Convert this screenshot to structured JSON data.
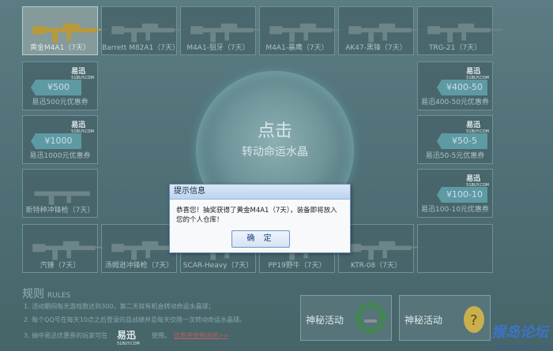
{
  "weapons_row1": [
    {
      "label": "黄金M4A1（7天）",
      "selected": true
    },
    {
      "label": "Barrett M82A1（7天）"
    },
    {
      "label": "M4A1-狙牙（7天）"
    },
    {
      "label": "M4A1-暴鹰（7天）"
    },
    {
      "label": "AK47-黑锋（7天）"
    },
    {
      "label": "TRG-21（7天）"
    }
  ],
  "vouchers_left": [
    {
      "amount": "¥500",
      "label": "易迅500元优惠券",
      "logo": "易迅",
      "logo_sub": "51BUY.COM"
    },
    {
      "amount": "¥1000",
      "label": "易迅1000元优惠券",
      "logo": "易迅",
      "logo_sub": "51BUY.COM"
    }
  ],
  "vouchers_right": [
    {
      "amount": "¥400-50",
      "label": "易迅400-50元优惠券",
      "logo": "易迅",
      "logo_sub": "51BUY.COM"
    },
    {
      "amount": "¥50-5",
      "label": "易迅50-5元优惠券",
      "logo": "易迅",
      "logo_sub": "51BUY.COM"
    },
    {
      "amount": "¥100-10",
      "label": "易迅100-10元优惠券",
      "logo": "易迅",
      "logo_sub": "51BUY.COM"
    }
  ],
  "weapon_left_mid": {
    "label": "新特种冲锋枪（7天）"
  },
  "weapons_row_bottom": [
    {
      "label": "汽锤（7天）"
    },
    {
      "label": "汤姆逊冲锋枪（7天）"
    },
    {
      "label": "SCAR-Heavy（7天）"
    },
    {
      "label": "PP19野牛（7天）"
    },
    {
      "label": "KTR-08（7天）"
    }
  ],
  "orb": {
    "line1": "点击",
    "line2": "转动命运水晶"
  },
  "rules": {
    "heading": "规则",
    "heading_en": "RULES",
    "items": [
      "1. 活动期间每天游戏数达到300，第二天就有机会转动命运水晶球；",
      "2. 每个QQ号在每天10点之后登录的且战绩并且每天仅限一次转动命运水晶球。",
      "3. 抽中易迅优惠券的玩家可在",
      "使用。",
      "优惠券使用说明>>"
    ]
  },
  "bottom_logo": {
    "text": "易迅",
    "sub": "51BUY.COM"
  },
  "mystery": [
    {
      "label": "神秘活动"
    },
    {
      "label": "神秘活动"
    }
  ],
  "watermark": {
    "main": "猴岛论坛",
    "sub": "BBS.HOUDAO.COM"
  },
  "dialog": {
    "title": "提示信息",
    "message": "恭喜您！抽奖获得了黄金M4A1（7天），装备即将放入您的个人仓库！",
    "ok": "确 定"
  }
}
